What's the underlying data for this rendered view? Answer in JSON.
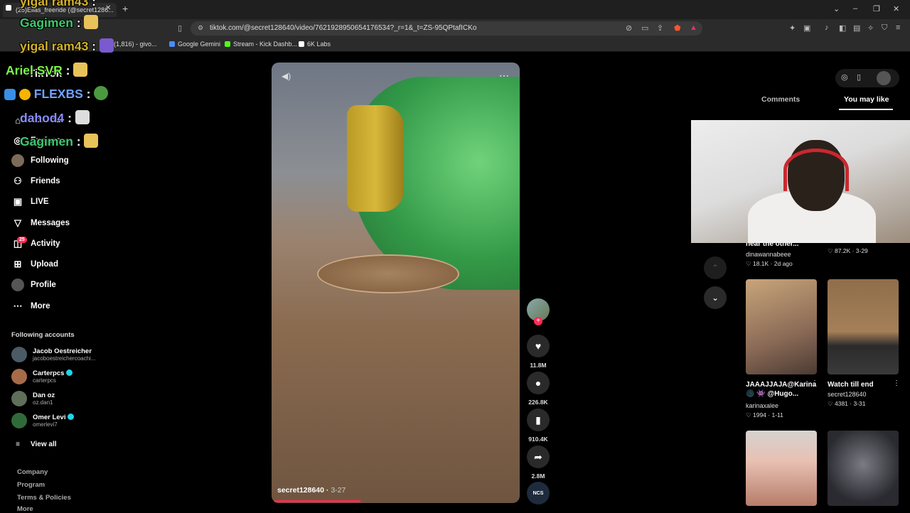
{
  "browser": {
    "tab_title": "(25)Elias_freeride (@secret1286...",
    "url": "tiktok.com/@secret128640/video/7621928950654176534?_r=1&_t=ZS-95QPtafICKo",
    "bookmarks": [
      "(1,816) - givo...",
      "Google Gemini",
      "Stream - Kick Dashb...",
      "6K Labs"
    ]
  },
  "chat": [
    {
      "user": "yigal ram43",
      "sep": " :",
      "color": "#d3b12a"
    },
    {
      "user": "Gagimen",
      "sep": " :",
      "color": "#3fc86f"
    },
    {
      "user": "yigal ram43",
      "sep": " :",
      "color": "#d3b12a"
    },
    {
      "user": "Ariel SVR",
      "sep": " :",
      "color": "#7cf24a"
    },
    {
      "user": "FLEXBS",
      "sep": " :",
      "color": "#6fa3ff"
    },
    {
      "user": "dahod4",
      "sep": " :",
      "color": "#8a8cff"
    },
    {
      "user": "Gagimen",
      "sep": " :",
      "color": "#3fc86f"
    }
  ],
  "sidebar": {
    "brand": "TikTok",
    "nav": [
      {
        "label": "For You",
        "icon": "home-icon"
      },
      {
        "label": "Explore",
        "icon": "compass-icon"
      },
      {
        "label": "Following",
        "icon": "following-avatar-icon"
      },
      {
        "label": "Friends",
        "icon": "friends-icon"
      },
      {
        "label": "LIVE",
        "icon": "live-icon"
      },
      {
        "label": "Messages",
        "icon": "messages-icon"
      },
      {
        "label": "Activity",
        "icon": "activity-icon"
      },
      {
        "label": "Upload",
        "icon": "upload-icon"
      },
      {
        "label": "Profile",
        "icon": "profile-icon"
      },
      {
        "label": "More",
        "icon": "more-icon"
      }
    ],
    "activity_badge": "25",
    "following_header": "Following accounts",
    "accounts": [
      {
        "name": "Jacob Oestreicher",
        "handle": "jacoboestreichercoachi...",
        "verified": false
      },
      {
        "name": "Carterpcs",
        "handle": "carterpcs",
        "verified": true
      },
      {
        "name": "Dan oz",
        "handle": "oz.dan1",
        "verified": false
      },
      {
        "name": "Omer Levi",
        "handle": "omerlevi7",
        "verified": true
      }
    ],
    "view_all": "View all",
    "footer": [
      "Company",
      "Program",
      "Terms & Policies",
      "More"
    ]
  },
  "video": {
    "author": "secret128640",
    "date": "3-27",
    "progress": 0.35
  },
  "actions": {
    "likes": "11.8M",
    "comments": "226.8K",
    "saves": "910.4K",
    "shares": "2.8M",
    "music_label": "NCS"
  },
  "right_panel": {
    "tabs": [
      "Comments",
      "You may like"
    ],
    "active_tab": "You may like",
    "cards": [
      {
        "title": "hear the other...",
        "author": "dinawannabeee",
        "likes": "18.1K",
        "date": "2d ago"
      },
      {
        "title": "",
        "author": "",
        "likes": "87.2K",
        "date": "3-29"
      },
      {
        "title": "JAAAJJAJA@Karina🌑 👾 @Hugo...",
        "author": "karinaxalee",
        "likes": "1994",
        "date": "1-11"
      },
      {
        "title": "Watch till end",
        "author": "secret128640",
        "likes": "4381",
        "date": "3-31"
      }
    ]
  },
  "colors": {
    "accent": "#fe2c55",
    "verified": "#20d5ec"
  }
}
